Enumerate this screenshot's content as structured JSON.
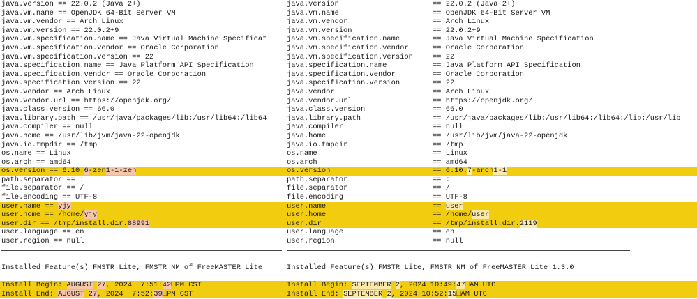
{
  "left": {
    "props": [
      {
        "key": "java.version",
        "value": "22.0.2 (Java 2+)"
      },
      {
        "key": "java.vm.name",
        "value": "OpenJDK 64-Bit Server VM"
      },
      {
        "key": "java.vm.vendor",
        "value": "Arch Linux"
      },
      {
        "key": "java.vm.version",
        "value": "22.0.2+9"
      },
      {
        "key": "java.vm.specification.name",
        "value": "Java Virtual Machine Specificat"
      },
      {
        "key": "java.vm.specification.vendor",
        "value": "Oracle Corporation"
      },
      {
        "key": "java.vm.specification.version",
        "value": "22"
      },
      {
        "key": "java.specification.name",
        "value": "Java Platform API Specification"
      },
      {
        "key": "java.specification.vendor",
        "value": "Oracle Corporation"
      },
      {
        "key": "java.specification.version",
        "value": "22"
      },
      {
        "key": "java.vendor",
        "value": "Arch Linux"
      },
      {
        "key": "java.vendor.url",
        "value": "https://openjdk.org/"
      },
      {
        "key": "java.class.version",
        "value": "66.0"
      },
      {
        "key": "java.library.path",
        "value": "/usr/java/packages/lib:/usr/lib64:/lib64"
      },
      {
        "key": "java.compiler",
        "value": "null"
      },
      {
        "key": "java.home",
        "value": "/usr/lib/jvm/java-22-openjdk"
      },
      {
        "key": "java.io.tmpdir",
        "value": "/tmp"
      },
      {
        "key": "os.name",
        "value": "Linux"
      },
      {
        "key": "os.arch",
        "value": "amd64"
      },
      {
        "key": "os.version",
        "pre": "6.10.",
        "hl": "6",
        "mid": "-zen",
        "hl2": "1-1-zen",
        "post": "",
        "changed": true
      },
      {
        "key": "path.separator",
        "value": ":"
      },
      {
        "key": "file.separator",
        "value": "/"
      },
      {
        "key": "file.encoding",
        "value": "UTF-8"
      },
      {
        "key": "user.name",
        "pre": "",
        "hl": "yjy",
        "mid": "",
        "hl2": "",
        "post": "",
        "changed": true
      },
      {
        "key": "user.home",
        "pre": "/home/",
        "hl": "yjy",
        "mid": "",
        "hl2": "",
        "post": "",
        "changed": true
      },
      {
        "key": "user.dir",
        "pre": "/tmp/install.dir.",
        "hl": "88991",
        "mid": "",
        "hl2": "",
        "post": "",
        "changed": true
      },
      {
        "key": "user.language",
        "value": "en"
      },
      {
        "key": "user.region",
        "value": "null"
      }
    ],
    "installed": "Installed Feature(s) FMSTR Lite, FMSTR NM of FreeMASTER Lite",
    "install_begin": {
      "label": "Install Begin: ",
      "a": "AUGUST",
      "b": " ",
      "c": "27",
      "d": ", 2024  7:51:",
      "e": "42",
      "f": "PM CST"
    },
    "install_end": {
      "label": "Install End: ",
      "a": "AUGUST",
      "b": " ",
      "c": "27",
      "d": ", 2024  7:52:",
      "e": "39",
      "f": "PM CST"
    }
  },
  "right": {
    "props": [
      {
        "key": "java.version",
        "value": "22.0.2 (Java 2+)"
      },
      {
        "key": "java.vm.name",
        "value": "OpenJDK 64-Bit Server VM"
      },
      {
        "key": "java.vm.vendor",
        "value": "Arch Linux"
      },
      {
        "key": "java.vm.version",
        "value": "22.0.2+9"
      },
      {
        "key": "java.vm.specification.name",
        "value": "Java Virtual Machine Specification"
      },
      {
        "key": "java.vm.specification.vendor",
        "value": "Oracle Corporation"
      },
      {
        "key": "java.vm.specification.version",
        "value": "22"
      },
      {
        "key": "java.specification.name",
        "value": "Java Platform API Specification"
      },
      {
        "key": "java.specification.vendor",
        "value": "Oracle Corporation"
      },
      {
        "key": "java.specification.version",
        "value": "22"
      },
      {
        "key": "java.vendor",
        "value": "Arch Linux"
      },
      {
        "key": "java.vendor.url",
        "value": "https://openjdk.org/"
      },
      {
        "key": "java.class.version",
        "value": "66.0"
      },
      {
        "key": "java.library.path",
        "value": "/usr/java/packages/lib:/usr/lib64:/lib64:/lib:/usr/lib"
      },
      {
        "key": "java.compiler",
        "value": "null"
      },
      {
        "key": "java.home",
        "value": "/usr/lib/jvm/java-22-openjdk"
      },
      {
        "key": "java.io.tmpdir",
        "value": "/tmp"
      },
      {
        "key": "os.name",
        "value": "Linux"
      },
      {
        "key": "os.arch",
        "value": "amd64"
      },
      {
        "key": "os.version",
        "pre": "6.10.",
        "hl": "7",
        "mid": "-arch",
        "hl2": "1-1",
        "post": "",
        "changed": true
      },
      {
        "key": "path.separator",
        "value": ":"
      },
      {
        "key": "file.separator",
        "value": "/"
      },
      {
        "key": "file.encoding",
        "value": "UTF-8"
      },
      {
        "key": "user.name",
        "pre": "",
        "hl": "user",
        "mid": "",
        "hl2": "",
        "post": "",
        "changed": true
      },
      {
        "key": "user.home",
        "pre": "/home/",
        "hl": "user",
        "mid": "",
        "hl2": "",
        "post": "",
        "changed": true
      },
      {
        "key": "user.dir",
        "pre": "/tmp/install.dir.",
        "hl": "2119",
        "mid": "",
        "hl2": "",
        "post": "",
        "changed": true
      },
      {
        "key": "user.language",
        "value": "en"
      },
      {
        "key": "user.region",
        "value": "null"
      }
    ],
    "installed": "Installed Feature(s) FMSTR Lite, FMSTR NM of FreeMASTER Lite 1.3.0",
    "install_begin": {
      "label": "Install Begin: ",
      "a": "SEPTEMBER",
      "b": " ",
      "c": "2",
      "d": ", 2024 10:49:",
      "e": "47",
      "f": "AM UTC"
    },
    "install_end": {
      "label": "Install End: ",
      "a": "SEPTEMBER",
      "b": " ",
      "c": "2",
      "d": ", 2024 10:52:",
      "e": "15",
      "f": "AM UTC"
    }
  },
  "separator": "==",
  "glyph": "□",
  "colors": {
    "changed_line": "#f2cc0f",
    "left_highlight": "#f5c6a8",
    "right_highlight": "#fbe9a9"
  }
}
